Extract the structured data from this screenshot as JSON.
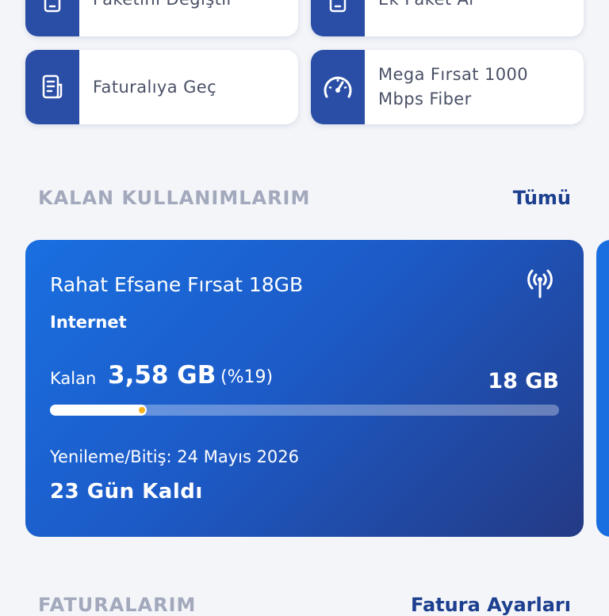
{
  "actions": [
    {
      "label": "Paketini Değiştir",
      "icon": "phone-icon"
    },
    {
      "label": "Ek Paket Al",
      "icon": "phone-icon"
    },
    {
      "label": "Faturalıya Geç",
      "icon": "invoice-icon"
    },
    {
      "label": "Mega Fırsat 1000\nMbps Fiber",
      "icon": "speedometer-icon"
    }
  ],
  "usage_section": {
    "title": "KALAN KULLANIMLARIM",
    "link": "Tümü"
  },
  "usage_card": {
    "package_name": "Rahat Efsane Fırsat 18GB",
    "type": "Internet",
    "remaining_label": "Kalan",
    "remaining_value": "3,58 GB",
    "remaining_percent_text": "(%19)",
    "remaining_fraction": 0.19,
    "total": "18 GB",
    "renewal": "Yenileme/Bitiş: 24 Mayıs 2026",
    "days_left": "23 Gün Kaldı",
    "icon": "signal-antenna-icon"
  },
  "bills_section": {
    "title": "FATURALARIM",
    "link": "Fatura Ayarları"
  },
  "colors": {
    "accent": "#2a4ea6",
    "card_start": "#1a6fe0",
    "card_end": "#243a85",
    "progress_dot": "#f6b21b"
  }
}
